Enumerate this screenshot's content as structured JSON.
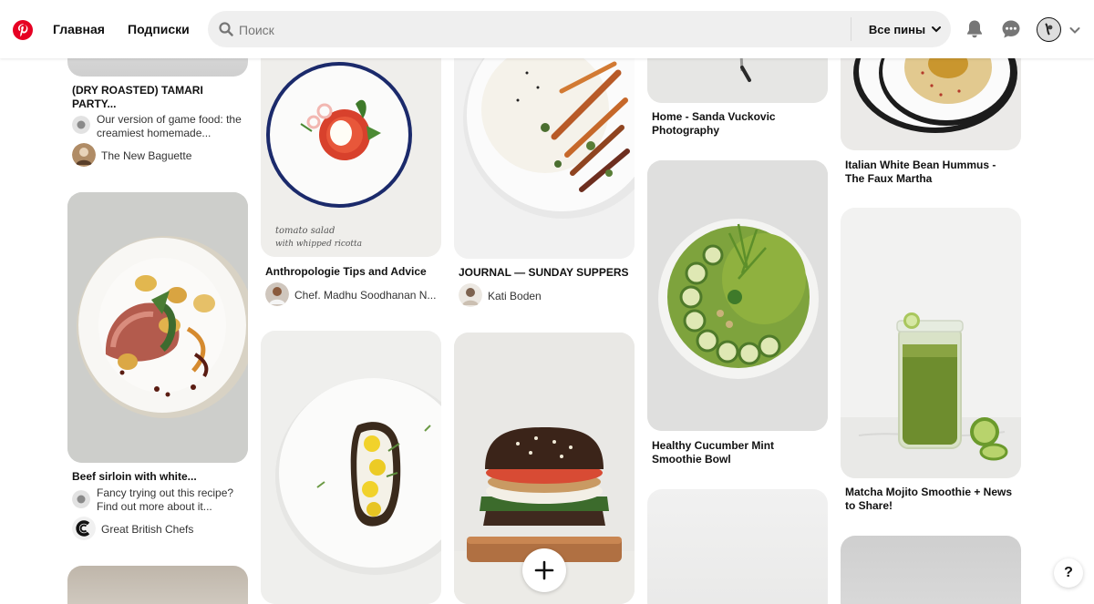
{
  "header": {
    "nav_home": "Главная",
    "nav_following": "Подписки",
    "search_placeholder": "Поиск",
    "filter_label": "Все пины",
    "brand_color": "#e60023"
  },
  "icons": [
    "pinterest-logo-icon",
    "search-icon",
    "chevron-down-icon",
    "bell-icon",
    "chat-icon",
    "plus-icon",
    "help-icon"
  ],
  "pins": [
    {
      "title": "(DRY ROASTED) TAMARI PARTY...",
      "description": "Our version of game food: the creamiest homemade...",
      "author": "The New Baguette"
    },
    {
      "title": "Beef sirloin with white...",
      "description": "Fancy trying out this recipe? Find out more about it...",
      "author": "Great British Chefs"
    },
    {
      "title": "Anthropologie Tips and Advice",
      "author": "Chef. Madhu Soodhanan N...",
      "image_text": "tomato salad with whipped ricotta"
    },
    {
      "title": "JOURNAL — SUNDAY SUPPERS",
      "author": "Kati Boden"
    },
    {
      "title": "Home - Sanda Vuckovic Photography"
    },
    {
      "title": "Healthy Cucumber Mint Smoothie Bowl"
    },
    {
      "title": "Italian White Bean Hummus - The Faux Martha"
    },
    {
      "title": "Matcha Mojito Smoothie + News to Share!"
    }
  ],
  "help_label": "?"
}
